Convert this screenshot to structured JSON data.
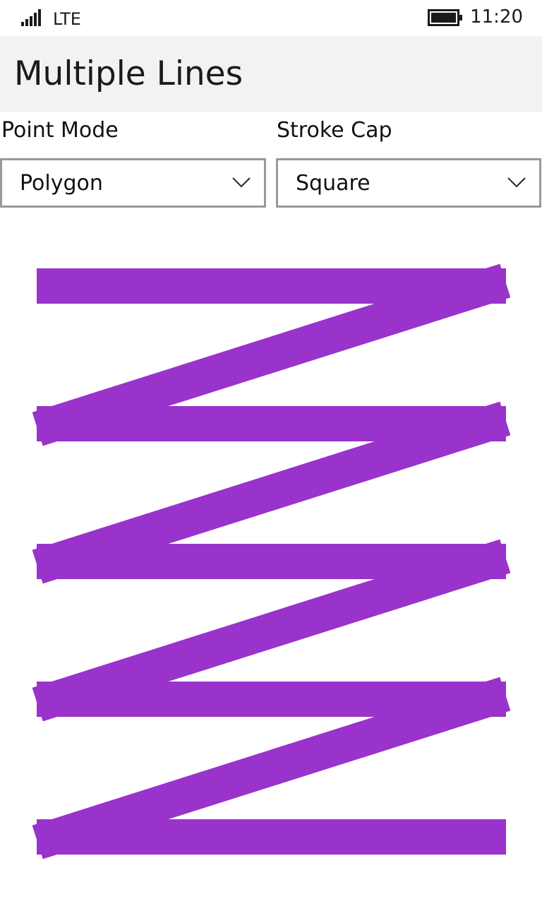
{
  "status_bar": {
    "network": "LTE",
    "time": "11:20",
    "signal_icon": "signal-bars-icon",
    "battery_icon": "battery-full-icon"
  },
  "header": {
    "title": "Multiple Lines"
  },
  "controls": {
    "point_mode": {
      "label": "Point Mode",
      "value": "Polygon"
    },
    "stroke_cap": {
      "label": "Stroke Cap",
      "value": "Square"
    }
  },
  "canvas": {
    "stroke_color": "#9933CC",
    "zigzag_rows": 5
  }
}
